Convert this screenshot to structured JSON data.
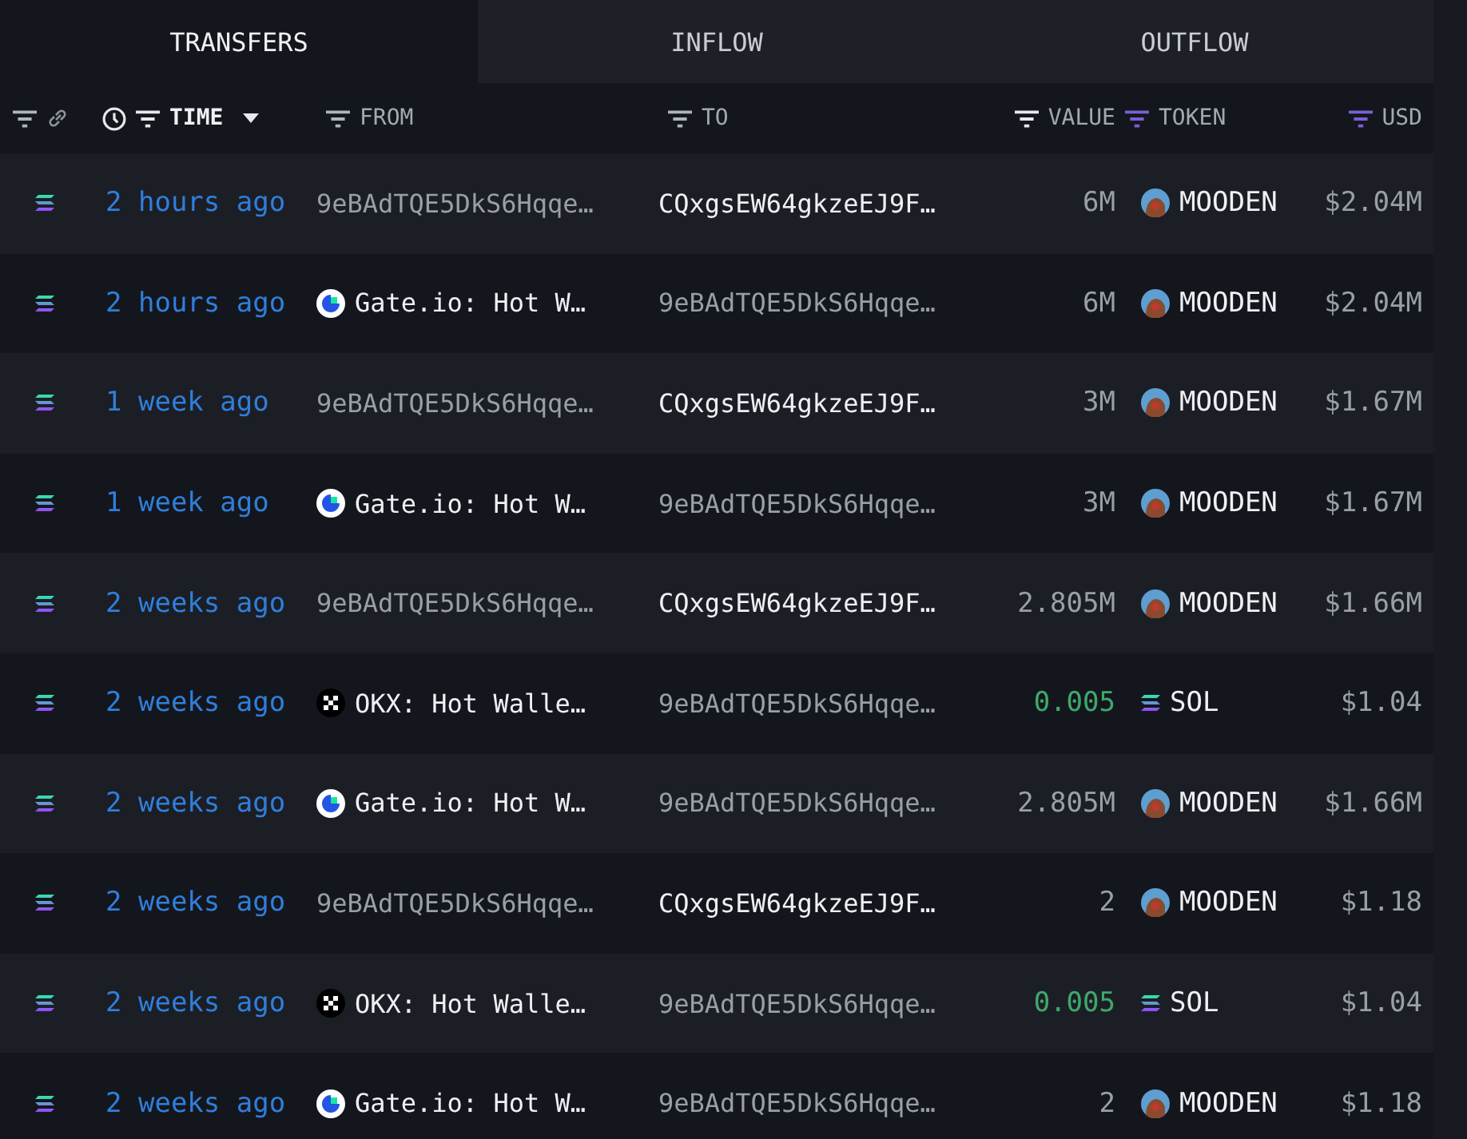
{
  "tabs": [
    {
      "label": "TRANSFERS",
      "selected": true
    },
    {
      "label": "INFLOW",
      "selected": false
    },
    {
      "label": "OUTFLOW",
      "selected": false
    }
  ],
  "columns": {
    "time": "TIME",
    "from": "FROM",
    "to": "TO",
    "value": "VALUE",
    "token": "TOKEN",
    "usd": "USD"
  },
  "rows": [
    {
      "time": "2 hours ago",
      "from": {
        "text": "9eBAdTQE5DkS6Hqqe…",
        "labeled": false
      },
      "to": {
        "text": "CQxgsEW64gkzeEJ9F…",
        "labeled": true
      },
      "value": "6M",
      "token": {
        "name": "MOODEN",
        "kind": "mooden"
      },
      "usd": "$2.04M"
    },
    {
      "time": "2 hours ago",
      "from": {
        "text": "Gate.io: Hot W…",
        "labeled": true,
        "kind": "gate"
      },
      "to": {
        "text": "9eBAdTQE5DkS6Hqqe…",
        "labeled": false
      },
      "value": "6M",
      "token": {
        "name": "MOODEN",
        "kind": "mooden"
      },
      "usd": "$2.04M"
    },
    {
      "time": "1 week ago",
      "from": {
        "text": "9eBAdTQE5DkS6Hqqe…",
        "labeled": false
      },
      "to": {
        "text": "CQxgsEW64gkzeEJ9F…",
        "labeled": true
      },
      "value": "3M",
      "token": {
        "name": "MOODEN",
        "kind": "mooden"
      },
      "usd": "$1.67M"
    },
    {
      "time": "1 week ago",
      "from": {
        "text": "Gate.io: Hot W…",
        "labeled": true,
        "kind": "gate"
      },
      "to": {
        "text": "9eBAdTQE5DkS6Hqqe…",
        "labeled": false
      },
      "value": "3M",
      "token": {
        "name": "MOODEN",
        "kind": "mooden"
      },
      "usd": "$1.67M"
    },
    {
      "time": "2 weeks ago",
      "from": {
        "text": "9eBAdTQE5DkS6Hqqe…",
        "labeled": false
      },
      "to": {
        "text": "CQxgsEW64gkzeEJ9F…",
        "labeled": true
      },
      "value": "2.805M",
      "token": {
        "name": "MOODEN",
        "kind": "mooden"
      },
      "usd": "$1.66M"
    },
    {
      "time": "2 weeks ago",
      "from": {
        "text": "OKX: Hot Walle…",
        "labeled": true,
        "kind": "okx"
      },
      "to": {
        "text": "9eBAdTQE5DkS6Hqqe…",
        "labeled": false
      },
      "value": "0.005",
      "token": {
        "name": "SOL",
        "kind": "sol"
      },
      "usd": "$1.04"
    },
    {
      "time": "2 weeks ago",
      "from": {
        "text": "Gate.io: Hot W…",
        "labeled": true,
        "kind": "gate"
      },
      "to": {
        "text": "9eBAdTQE5DkS6Hqqe…",
        "labeled": false
      },
      "value": "2.805M",
      "token": {
        "name": "MOODEN",
        "kind": "mooden"
      },
      "usd": "$1.66M"
    },
    {
      "time": "2 weeks ago",
      "from": {
        "text": "9eBAdTQE5DkS6Hqqe…",
        "labeled": false
      },
      "to": {
        "text": "CQxgsEW64gkzeEJ9F…",
        "labeled": true
      },
      "value": "2",
      "token": {
        "name": "MOODEN",
        "kind": "mooden"
      },
      "usd": "$1.18"
    },
    {
      "time": "2 weeks ago",
      "from": {
        "text": "OKX: Hot Walle…",
        "labeled": true,
        "kind": "okx"
      },
      "to": {
        "text": "9eBAdTQE5DkS6Hqqe…",
        "labeled": false
      },
      "value": "0.005",
      "token": {
        "name": "SOL",
        "kind": "sol"
      },
      "usd": "$1.04"
    },
    {
      "time": "2 weeks ago",
      "from": {
        "text": "Gate.io: Hot W…",
        "labeled": true,
        "kind": "gate"
      },
      "to": {
        "text": "9eBAdTQE5DkS6Hqqe…",
        "labeled": false
      },
      "value": "2",
      "token": {
        "name": "MOODEN",
        "kind": "mooden"
      },
      "usd": "$1.18"
    }
  ]
}
